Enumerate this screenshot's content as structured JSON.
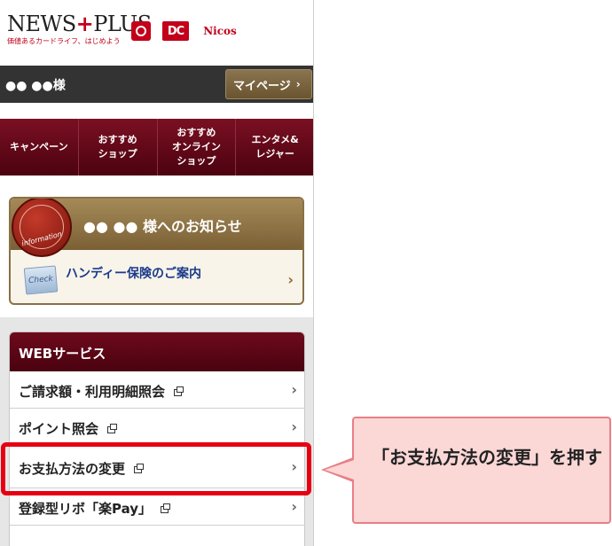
{
  "header": {
    "logo_main": "NEWS",
    "logo_plus": "+",
    "logo_end": "PLUS",
    "logo_tagline": "価値あるカードライフ、はじめよう",
    "brands": [
      "Nicos"
    ]
  },
  "userbar": {
    "username": "●● ●●様",
    "mypage_label": "マイページ",
    "mypage_chevron": "›"
  },
  "nav": {
    "items": [
      {
        "label": "キャンペーン"
      },
      {
        "label": "おすすめ\nショップ"
      },
      {
        "label": "おすすめ\nオンライン\nショップ"
      },
      {
        "label": "エンタメ&\nレジャー"
      }
    ]
  },
  "info": {
    "seal_text": "information",
    "title": "●● ●● 様へのお知らせ",
    "check_label": "Check",
    "link_text": "ハンディー保険のご案内",
    "chevron": "›"
  },
  "web_services": {
    "title": "WEBサービス",
    "items": [
      {
        "label": "ご請求額・利用明細照会",
        "chevron": "›"
      },
      {
        "label": "ポイント照会",
        "chevron": "›"
      },
      {
        "label": "お支払方法の変更",
        "chevron": "›"
      },
      {
        "label": "登録型リボ「楽Pay」",
        "chevron": "›"
      }
    ]
  },
  "callout": {
    "text": "「お支払方法の変更」を押す"
  },
  "colors": {
    "accent": "#c2001b",
    "highlight": "#e60012",
    "callout_bg": "#fbd7d6",
    "nav_bg": "#5c0514"
  }
}
